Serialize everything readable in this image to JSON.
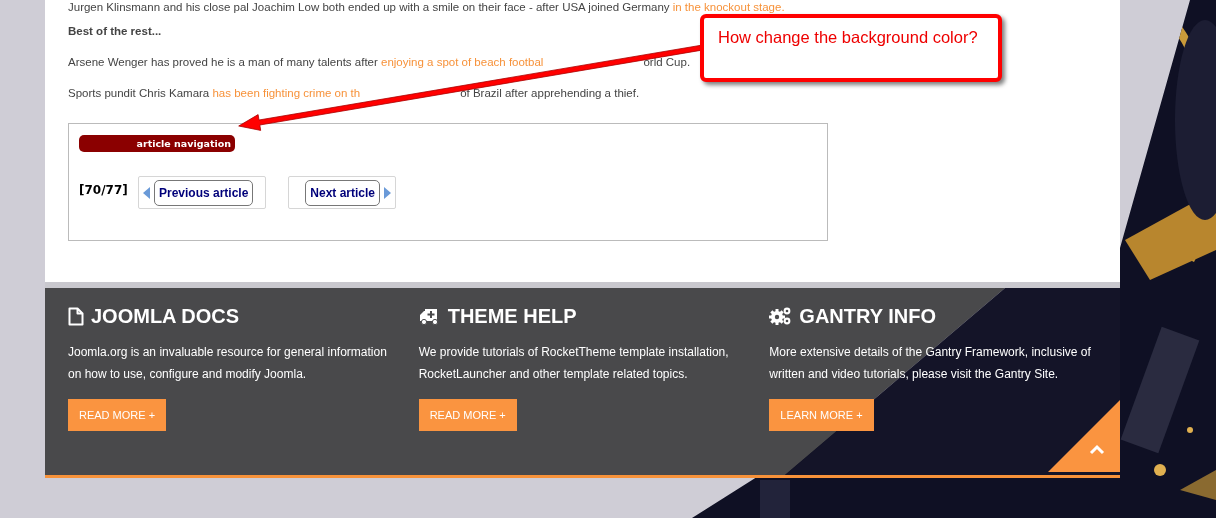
{
  "article": {
    "top_line": [
      {
        "text": "Jurgen Klinsmann and his close pal Joachim Low both ended up with a smile on their face - after USA joined Germany ",
        "link": false
      },
      {
        "text": "in the knockout stage.",
        "link": true
      }
    ],
    "heading": "Best of the rest...",
    "paragraphs": [
      {
        "parts": [
          [
            {
              "text": "Arsene Wenger has proved he is a man of many talents after ",
              "link": false
            },
            {
              "text": "enjoying a spot of beach footbal",
              "link": true
            }
          ],
          [
            {
              "text": "orld Cup.",
              "link": false
            }
          ]
        ]
      },
      {
        "parts": [
          [
            {
              "text": "Sports pundit Chris Kamara ",
              "link": false
            },
            {
              "text": "has been fighting crime on th",
              "link": true
            }
          ],
          [
            {
              "text": "of Brazil after apprehending a thief.",
              "link": false
            }
          ]
        ]
      }
    ]
  },
  "article_navigation": {
    "badge": "article navigation",
    "counter": "[70/77]",
    "previous": "Previous article",
    "next": "Next article"
  },
  "footer": {
    "columns": [
      {
        "kind": "document",
        "title": "JOOMLA DOCS",
        "text": "Joomla.org is an invaluable resource for general information on how to use, configure and modify Joomla.",
        "button": "READ MORE +"
      },
      {
        "kind": "ambulance",
        "title": "THEME HELP",
        "text": "We provide tutorials of RocketTheme template installation, RocketLauncher and other template related topics.",
        "button": "READ MORE +"
      },
      {
        "kind": "gears",
        "title": "GANTRY INFO",
        "text": "More extensive details of the Gantry Framework, inclusive of written and video tutorials, please visit the Gantry Site.",
        "button": "LEARN MORE +"
      }
    ]
  },
  "callout": {
    "text": "How change the background color?"
  }
}
